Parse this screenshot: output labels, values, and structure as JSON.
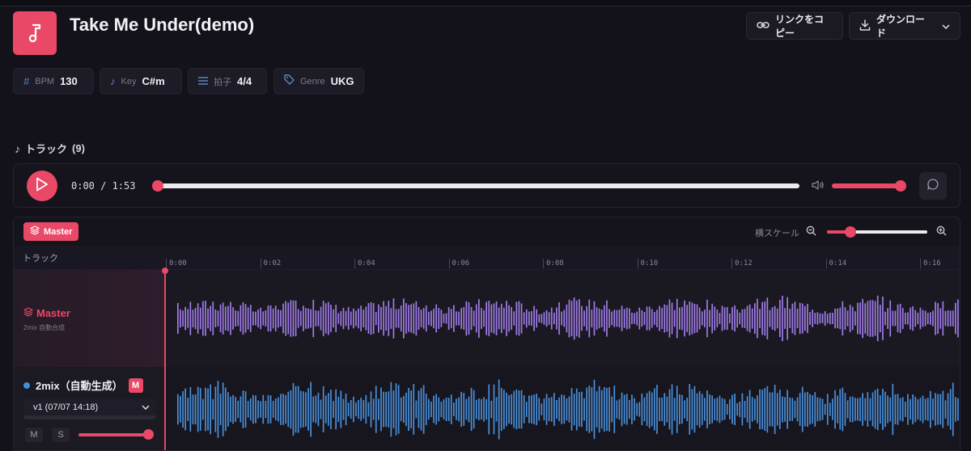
{
  "song": {
    "title": "Take Me Under(demo)"
  },
  "actions": {
    "copy_link": "リンクをコピー",
    "download": "ダウンロード"
  },
  "meta": [
    {
      "label": "BPM",
      "value": "130"
    },
    {
      "label": "Key",
      "value": "C#m"
    },
    {
      "label": "拍子",
      "value": "4/4"
    },
    {
      "label": "Genre",
      "value": "UKG"
    }
  ],
  "tracks_section": {
    "label": "トラック",
    "count": "(9)"
  },
  "player": {
    "time": "0:00 / 1:53",
    "progress": 0.0,
    "volume": 1.0
  },
  "editor": {
    "master_badge": "Master",
    "scale_label": "横スケール",
    "zoom_level": 0.2,
    "track_header": "トラック",
    "ruler_ticks": [
      "0:00",
      "0:02",
      "0:04",
      "0:06",
      "0:08",
      "0:10",
      "0:12",
      "0:14",
      "0:16"
    ],
    "master_track": {
      "name": "Master",
      "sub": "2mix 自動合成",
      "color": "#a07ce8"
    },
    "track2": {
      "name": "2mix（自動生成）",
      "badge": "M",
      "version": "v1 (07/07 14:18)",
      "mute": "M",
      "solo": "S",
      "volume": 0.95,
      "color": "#4a90d9"
    }
  },
  "colors": {
    "accent": "#ea4867",
    "background": "#13111a"
  }
}
